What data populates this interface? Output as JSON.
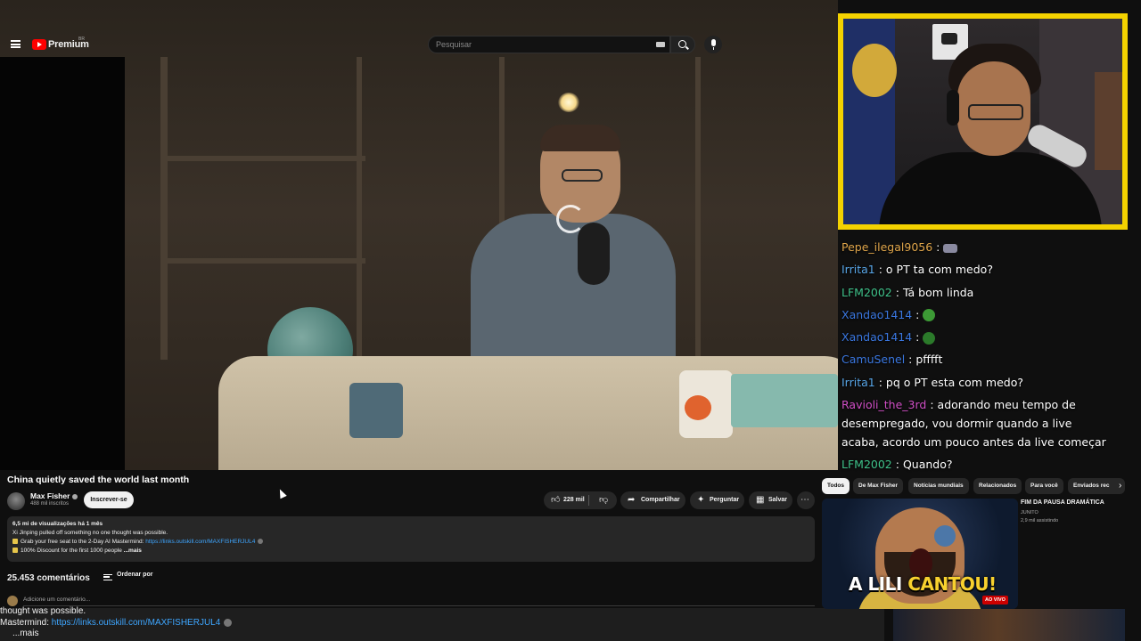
{
  "header": {
    "logo_text": "Premium",
    "logo_sup": "BR",
    "search_placeholder": "Pesquisar"
  },
  "chat": [
    {
      "user": "Pepe_ilegal9056",
      "color": "#e0a64b",
      "message": "",
      "emote": "car-emote"
    },
    {
      "user": "Irrita1",
      "color": "#58a6e8",
      "message": "o PT ta com medo?",
      "emote": ""
    },
    {
      "user": "LFM2002",
      "color": "#3fc28a",
      "message": "Tá bom linda",
      "emote": ""
    },
    {
      "user": "Xandao1414",
      "color": "#3a77e0",
      "message": "",
      "emote": "frog-emote"
    },
    {
      "user": "Xandao1414",
      "color": "#3a77e0",
      "message": "",
      "emote": "frog-angry-emote"
    },
    {
      "user": "CamuSenel",
      "color": "#3a77e0",
      "message": "pfffft",
      "emote": ""
    },
    {
      "user": "Irrita1",
      "color": "#58a6e8",
      "message": "pq o PT esta com medo?",
      "emote": ""
    },
    {
      "user": "Ravioli_the_3rd",
      "color": "#d04fc6",
      "message": "adorando meu tempo de desempregado, vou dormir quando a live acaba, acordo um pouco antes da live começar",
      "emote": ""
    },
    {
      "user": "LFM2002",
      "color": "#3fc28a",
      "message": "Quando?",
      "emote": ""
    }
  ],
  "video": {
    "title": "China quietly saved the world last month",
    "channel": "Max Fisher",
    "subscribers": "488 mil inscritos",
    "subscribe_label": "Inscrever-se",
    "likes": "228 mil",
    "share_label": "Compartilhar",
    "ask_label": "Perguntar",
    "save_label": "Salvar"
  },
  "description": {
    "stats": "6,5 mi de visualizações  há 1 mês",
    "line1": "Xi Jinping pulled off something no one thought was possible.",
    "line2_text": "Grab your free seat to the 2-Day AI Mastermind: ",
    "line2_link": "https://links.outskill.com/MAXFISHERJUL4",
    "line3_text": "100% Discount for the first 1000 people",
    "more": "...mais"
  },
  "comments": {
    "count": "25.453 comentários",
    "sort_label": "Ordenar por",
    "add_placeholder": "Adicione um comentário..."
  },
  "bottom_overlay": {
    "line1": "thought was possible.",
    "line2_text": "Mastermind: ",
    "line2_link": "https://links.outskill.com/MAXFISHERJUL4",
    "line3": "...mais"
  },
  "chips": [
    "Todos",
    "De Max Fisher",
    "Notícias mundiais",
    "Relacionados",
    "Para você",
    "Enviados rec"
  ],
  "related": {
    "thumb_text_white": "A LILI ",
    "thumb_text_yellow": "CANTOU!",
    "live_badge": "AO VIVO",
    "title": "FIM DA PAUSA DRAMÁTICA",
    "channel": "JUNITO",
    "views": "2,9 mil assistindo"
  },
  "colors": {
    "webcam_border": "#f4d200",
    "youtube_red": "#ff0000",
    "link_blue": "#3ea6ff"
  }
}
